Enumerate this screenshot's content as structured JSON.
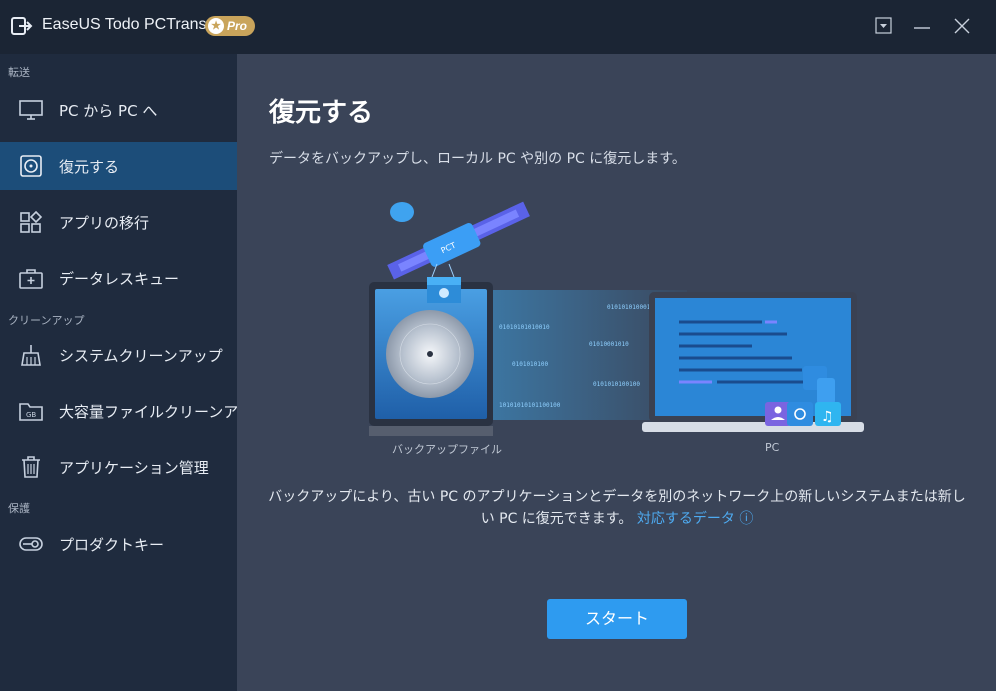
{
  "titlebar": {
    "title": "EaseUS Todo PCTrans",
    "badge": "Pro",
    "icons": [
      "app-logo-icon",
      "dropdown-icon",
      "minimize-icon",
      "close-icon"
    ]
  },
  "sidebar": {
    "sections": [
      {
        "label": "転送"
      },
      {
        "label": "クリーンアップ"
      },
      {
        "label": "保護"
      }
    ],
    "items": [
      {
        "label": "PC から PC へ",
        "icon": "monitor-icon"
      },
      {
        "label": "復元する",
        "icon": "disc-restore-icon",
        "active": true
      },
      {
        "label": "アプリの移行",
        "icon": "apps-icon"
      },
      {
        "label": "データレスキュー",
        "icon": "rescue-kit-icon"
      },
      {
        "label": "システムクリーンアップ",
        "icon": "broom-icon"
      },
      {
        "label": "大容量ファイルクリーンアップ",
        "icon": "large-file-folder-icon"
      },
      {
        "label": "アプリケーション管理",
        "icon": "trash-icon"
      },
      {
        "label": "プロダクトキー",
        "icon": "key-icon"
      }
    ]
  },
  "main": {
    "title": "復元する",
    "description": "データをバックアップし、ローカル PC や別の PC に復元します。",
    "caption_backup": "バックアップファイル",
    "caption_pc": "PC",
    "note": "バックアップにより、古い PC のアプリケーションとデータを別のネットワーク上の新しいシステムまたは新しい PC に復元できます。",
    "note_link": "対応するデータ",
    "info_icon": "info-icon",
    "start_label": "スタート"
  },
  "colors": {
    "accent": "#2e9bf0",
    "active_nav": "#1c4d79",
    "link": "#4eaaf0",
    "badge": "#c9a45b"
  }
}
